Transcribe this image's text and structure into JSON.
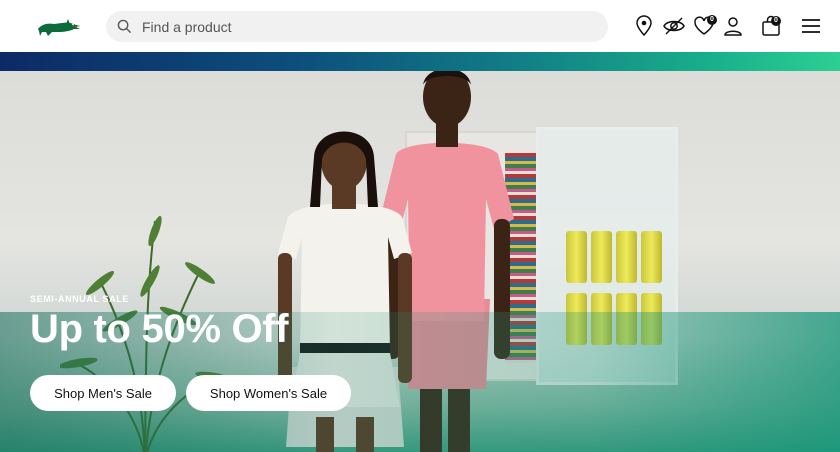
{
  "header": {
    "logo_name": "crocodile-logo",
    "search": {
      "placeholder": "Find a product",
      "value": ""
    },
    "icons": [
      "store-locator-icon",
      "accessibility-icon",
      "wishlist-icon",
      "account-icon",
      "cart-icon",
      "menu-icon"
    ],
    "wishlist_count": "0",
    "cart_count": "0"
  },
  "hero": {
    "eyebrow": "SEMI-ANNUAL SALE",
    "headline": "Up to 50% Off",
    "cta_men": "Shop Men's Sale",
    "cta_women": "Shop Women's Sale"
  },
  "colors": {
    "brand_green": "#0b6b3a",
    "strip_start": "#0d2a66",
    "strip_end": "#2ccf94"
  }
}
